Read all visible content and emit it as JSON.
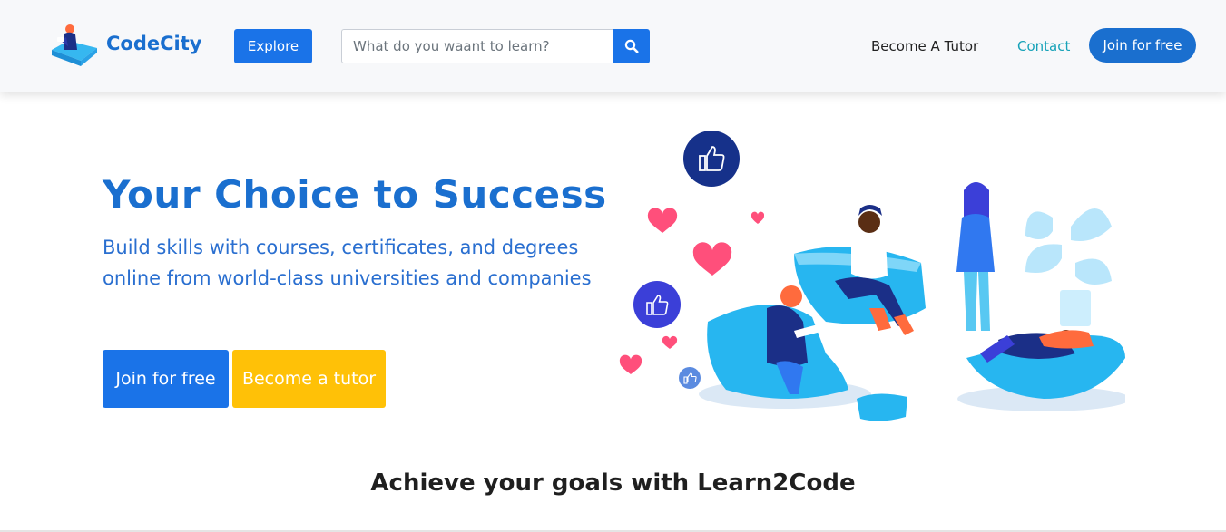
{
  "navbar": {
    "brand": "CodeCity",
    "explore_label": "Explore",
    "search": {
      "placeholder": "What do you waant to learn?",
      "icon": "search-icon"
    },
    "links": {
      "tutor": "Become A Tutor",
      "contact": "Contact"
    },
    "join_label": "Join for free"
  },
  "hero": {
    "title": "Your Choice to Success",
    "subtitle": "Build skills with courses, certificates, and degrees online from world-class universities and companies",
    "join_button": "Join for free",
    "tutor_button": "Become a tutor"
  },
  "section": {
    "heading": "Achieve your goals with Learn2Code"
  },
  "colors": {
    "primary": "#1a73e8",
    "brand": "#1a6fcf",
    "accent_yellow": "#ffc107",
    "contact_teal": "#17a2b8",
    "heart": "#ff4f7b"
  }
}
